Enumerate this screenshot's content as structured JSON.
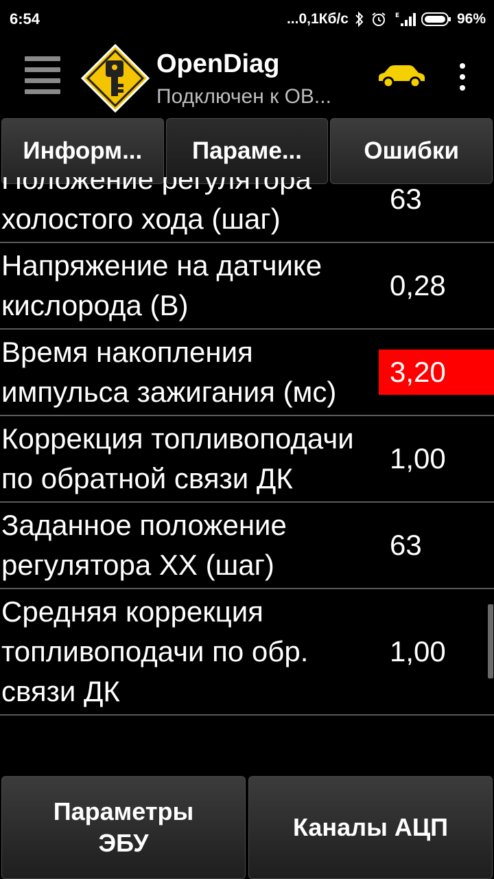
{
  "status_bar": {
    "time": "6:54",
    "speed": "...0,1Кб/с",
    "battery": "96%",
    "icons": [
      "bluetooth-icon",
      "alarm-icon",
      "signal-icon",
      "battery-icon"
    ]
  },
  "app_bar": {
    "title": "OpenDiag",
    "subtitle": "Подключен к ОВ...",
    "icons": [
      "menu-icon",
      "app-logo-icon",
      "car-icon",
      "overflow-menu-icon"
    ],
    "car_color": "#f5d000"
  },
  "tabs": [
    {
      "label": "Информ...",
      "active": false
    },
    {
      "label": "Параме...",
      "active": true
    },
    {
      "label": "Ошибки",
      "active": false
    }
  ],
  "params": [
    {
      "name": "Положение регулятора холостого хода (шаг)",
      "value": "63",
      "alert": false
    },
    {
      "name": "Напряжение на датчике кислорода (В)",
      "value": "0,28",
      "alert": false
    },
    {
      "name": "Время накопления импульса зажигания (мс)",
      "value": "3,20",
      "alert": true
    },
    {
      "name": "Коррекция топливоподачи по обратной связи ДК",
      "value": "1,00",
      "alert": false
    },
    {
      "name": "Заданное положение регулятора ХХ (шаг)",
      "value": "63",
      "alert": false
    },
    {
      "name": "Средняя коррекция топливоподачи по обр. связи ДК",
      "value": "1,00",
      "alert": false
    }
  ],
  "bottom_buttons": [
    {
      "label": "Параметры\nЭБУ"
    },
    {
      "label": "Каналы АЦП"
    }
  ],
  "colors": {
    "alert": "#ff0000",
    "logo": "#f5c400"
  }
}
